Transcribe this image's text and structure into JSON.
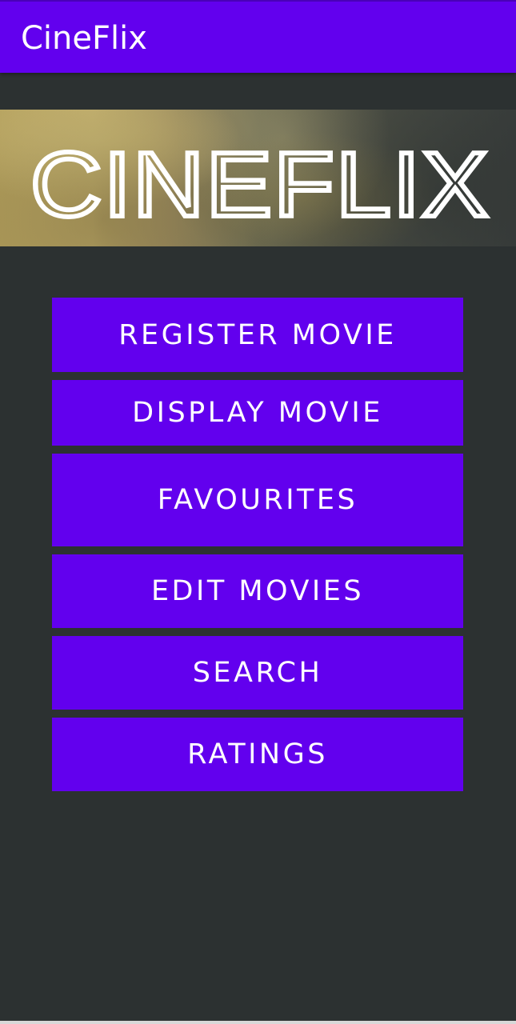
{
  "app_bar": {
    "title": "CineFlix"
  },
  "banner": {
    "logo_text": "CINEFLIX"
  },
  "menu": {
    "buttons": [
      {
        "label": "REGISTER MOVIE"
      },
      {
        "label": "DISPLAY MOVIE"
      },
      {
        "label": "FAVOURITES"
      },
      {
        "label": "EDIT MOVIES"
      },
      {
        "label": "SEARCH"
      },
      {
        "label": "RATINGS"
      }
    ]
  },
  "colors": {
    "primary": "#6200ee",
    "background": "#2c3131",
    "on_primary": "#ffffff"
  }
}
